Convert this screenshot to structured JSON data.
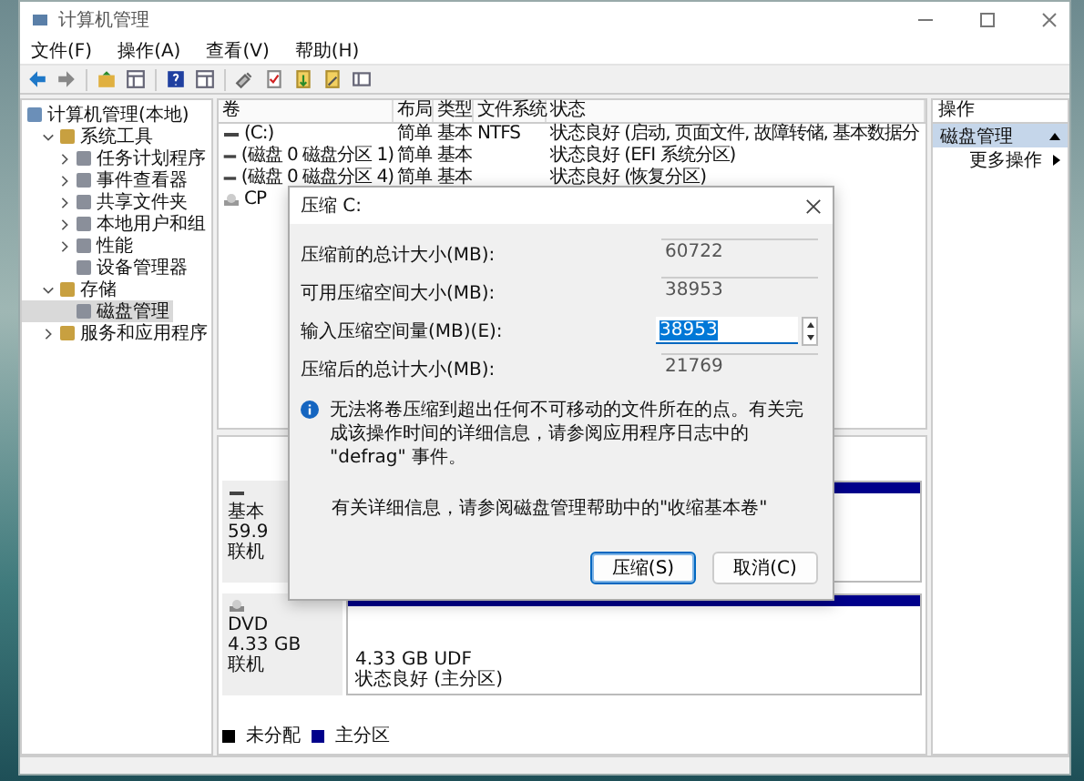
{
  "window": {
    "title": "计算机管理"
  },
  "menu": [
    "文件(F)",
    "操作(A)",
    "查看(V)",
    "帮助(H)"
  ],
  "tree": [
    {
      "label": "计算机管理(本地)",
      "selected": false,
      "children": [
        {
          "label": "系统工具",
          "expanded": true,
          "selected": false,
          "children": [
            {
              "label": "任务计划程序",
              "expanded": false,
              "selected": false
            },
            {
              "label": "事件查看器",
              "expanded": false,
              "selected": false
            },
            {
              "label": "共享文件夹",
              "expanded": false,
              "selected": false
            },
            {
              "label": "本地用户和组",
              "expanded": false,
              "selected": false
            },
            {
              "label": "性能",
              "expanded": false,
              "selected": false
            },
            {
              "label": "设备管理器",
              "selected": false
            }
          ]
        },
        {
          "label": "存储",
          "expanded": true,
          "selected": false,
          "children": [
            {
              "label": "磁盘管理",
              "selected": true
            }
          ]
        },
        {
          "label": "服务和应用程序",
          "expanded": false,
          "selected": false
        }
      ]
    }
  ],
  "table": {
    "columns": [
      "卷",
      "布局",
      "类型",
      "文件系统",
      "状态"
    ],
    "rows": [
      {
        "cells": [
          "(C:)",
          "简单",
          "基本",
          "NTFS",
          "状态良好 (启动, 页面文件, 故障转储, 基本数据分"
        ]
      },
      {
        "cells": [
          "(磁盘 0 磁盘分区 1)",
          "简单",
          "基本",
          "",
          "状态良好 (EFI 系统分区)"
        ]
      },
      {
        "cells": [
          "(磁盘 0 磁盘分区 4)",
          "简单",
          "基本",
          "",
          "状态良好 (恢复分区)"
        ]
      },
      {
        "cells": [
          "CP",
          "",
          "",
          "",
          ""
        ],
        "kind": "optical"
      }
    ]
  },
  "disks": [
    {
      "kind": "disk",
      "lines": [
        "基本",
        "59.9",
        "联机"
      ],
      "partitions": [
        {
          "kind": "primary"
        }
      ]
    },
    {
      "kind": "optical",
      "lines": [
        "DVD",
        "4.33 GB",
        "联机"
      ],
      "partitions": [
        {
          "kind": "primary",
          "lines": [
            "4.33 GB UDF",
            "状态良好 (主分区)"
          ]
        }
      ]
    }
  ],
  "legend": [
    {
      "label": "未分配",
      "color": "#000000"
    },
    {
      "label": "主分区",
      "color": "#00008b"
    }
  ],
  "actions": {
    "title": "操作",
    "section": {
      "label": "磁盘管理",
      "expanded": true
    },
    "items": [
      "更多操作"
    ]
  },
  "dialog": {
    "title": "压缩 C:",
    "fields": [
      {
        "label": "压缩前的总计大小(MB):",
        "value": "60722",
        "editable": false
      },
      {
        "label": "可用压缩空间大小(MB):",
        "value": "38953",
        "editable": false
      },
      {
        "label": "输入压缩空间量(MB)(E):",
        "value": "38953",
        "editable": true,
        "text_selected": true
      },
      {
        "label": "压缩后的总计大小(MB):",
        "value": "21769",
        "editable": false
      }
    ],
    "info": "无法将卷压缩到超出任何不可移动的文件所在的点。有关完成该操作时间的详细信息，请参阅应用程序日志中的 \"defrag\" 事件。",
    "help": "有关详细信息，请参阅磁盘管理帮助中的\"收缩基本卷\"",
    "buttons": [
      {
        "label": "压缩(S)",
        "default": true
      },
      {
        "label": "取消(C)",
        "default": false
      }
    ]
  }
}
